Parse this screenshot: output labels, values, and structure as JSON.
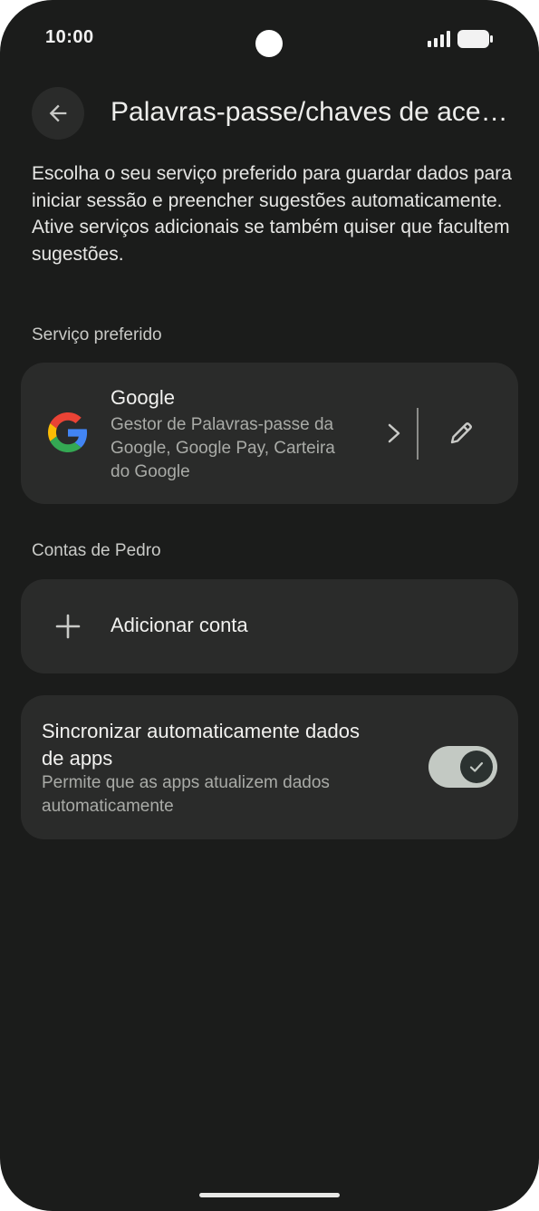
{
  "status_bar": {
    "time": "10:00"
  },
  "header": {
    "title": "Palavras-passe/chaves de acesso e contas",
    "back_icon": "arrow-left-icon"
  },
  "description": "Escolha o seu serviço preferido para guardar dados para iniciar sessão e preencher sugestões automaticamente. Ative serviços adicionais se também quiser que facultem sugestões.",
  "preferred_service": {
    "section_label": "Serviço preferido",
    "name": "Google",
    "description": "Gestor de Palavras-passe da Google, Google Pay, Carteira do Google",
    "logo_icon": "google-g-icon",
    "chevron_icon": "chevron-right-icon",
    "edit_icon": "pencil-icon"
  },
  "accounts": {
    "section_label": "Contas de Pedro",
    "add_label": "Adicionar conta",
    "add_icon": "plus-icon"
  },
  "sync": {
    "title": "Sincronizar automaticamente dados de apps",
    "description": "Permite que as apps atualizem dados automaticamente",
    "enabled": true
  },
  "colors": {
    "background": "#1b1c1b",
    "card": "#2a2b2a",
    "toggle_track": "#c3c9c3",
    "toggle_knob": "#2b3230"
  }
}
